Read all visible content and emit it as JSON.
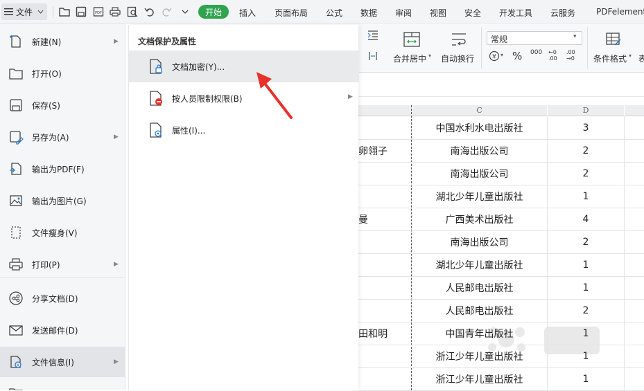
{
  "toolbar": {
    "file_label": "文件",
    "tabs": [
      "开始",
      "插入",
      "页面布局",
      "公式",
      "数据",
      "审阅",
      "视图",
      "安全",
      "开发工具",
      "云服务",
      "PDFelement"
    ]
  },
  "ribbon": {
    "merge_center": "合并居中",
    "auto_wrap": "自动换行",
    "number_format": "常规",
    "conditional_format": "条件格式",
    "table_style_partial": "表",
    "percent": "%",
    "thousands": "000",
    "dec_inc": "←0 .00",
    "dec_dec": ".00 →0"
  },
  "left_menu": {
    "items": [
      {
        "label": "新建(N)",
        "icon": "new-file-icon",
        "has_arrow": true
      },
      {
        "label": "打开(O)",
        "icon": "folder-open-icon",
        "has_arrow": false
      },
      {
        "label": "保存(S)",
        "icon": "save-icon",
        "has_arrow": false
      },
      {
        "label": "另存为(A)",
        "icon": "save-as-icon",
        "has_arrow": true
      },
      {
        "label": "输出为PDF(F)",
        "icon": "pdf-export-icon",
        "has_arrow": false
      },
      {
        "label": "输出为图片(G)",
        "icon": "image-export-icon",
        "has_arrow": false
      },
      {
        "label": "文件瘦身(V)",
        "icon": "file-slim-icon",
        "has_arrow": false
      },
      {
        "label": "打印(P)",
        "icon": "printer-icon",
        "has_arrow": true
      },
      {
        "label": "分享文档(D)",
        "icon": "share-icon",
        "has_arrow": false
      },
      {
        "label": "发送邮件(D)",
        "icon": "mail-icon",
        "has_arrow": false
      },
      {
        "label": "文件信息(I)",
        "icon": "file-info-icon",
        "has_arrow": true
      }
    ]
  },
  "submenu": {
    "title": "文档保护及属性",
    "items": [
      {
        "label": "文档加密(Y)...",
        "icon": "document-lock-icon"
      },
      {
        "label": "按人员限制权限(B)",
        "icon": "restrict-permission-icon"
      },
      {
        "label": "属性(I)...",
        "icon": "document-properties-icon"
      }
    ]
  },
  "sheet": {
    "col_c": "C",
    "col_d": "D",
    "rows": [
      {
        "b": "",
        "c": "中国水利水电出版社",
        "d": "3"
      },
      {
        "b": "卵翎子",
        "c": "南海出版公司",
        "d": "2"
      },
      {
        "b": "",
        "c": "南海出版公司",
        "d": "2"
      },
      {
        "b": "",
        "c": "湖北少年儿童出版社",
        "d": "1"
      },
      {
        "b": "曼",
        "c": "广西美术出版社",
        "d": "4"
      },
      {
        "b": "",
        "c": "南海出版公司",
        "d": "2"
      },
      {
        "b": "",
        "c": "湖北少年儿童出版社",
        "d": "1"
      },
      {
        "b": "",
        "c": "人民邮电出版社",
        "d": "1"
      },
      {
        "b": "",
        "c": "人民邮电出版社",
        "d": "2"
      },
      {
        "b": "田和明",
        "c": "中国青年出版社",
        "d": "1"
      },
      {
        "b": "",
        "c": "浙江少年儿童出版社",
        "d": "1"
      },
      {
        "b": "",
        "c": "浙江少年儿童出版社",
        "d": "1"
      }
    ]
  },
  "colors": {
    "accent_green": "#2fa44f",
    "arrow_red": "#e8312a"
  }
}
